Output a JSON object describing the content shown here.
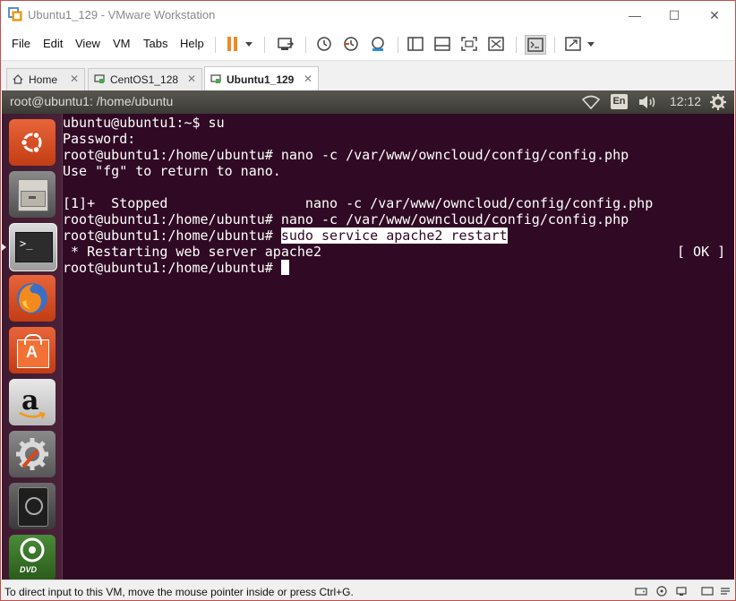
{
  "window": {
    "title": "Ubuntu1_129 - VMware Workstation",
    "minimize_glyph": "—",
    "maximize_glyph": "☐",
    "close_glyph": "✕"
  },
  "menu": {
    "items": [
      "File",
      "Edit",
      "View",
      "VM",
      "Tabs",
      "Help"
    ]
  },
  "tabs": [
    {
      "label": "Home",
      "active": false
    },
    {
      "label": "CentOS1_128",
      "active": false
    },
    {
      "label": "Ubuntu1_129",
      "active": true
    }
  ],
  "tab_close_glyph": "✕",
  "guest_panel": {
    "window_title": "root@ubuntu1: /home/ubuntu",
    "keyboard_layout": "En",
    "clock": "12:12"
  },
  "launcher": {
    "items": [
      "ubuntu-dash-icon",
      "files-icon",
      "terminal-icon",
      "firefox-icon",
      "software-center-icon",
      "amazon-icon",
      "system-settings-icon",
      "disk-icon",
      "dvd-icon"
    ]
  },
  "terminal": {
    "lines": [
      "ubuntu@ubuntu1:~$ su",
      "Password:",
      "root@ubuntu1:/home/ubuntu# nano -c /var/www/owncloud/config/config.php",
      "Use \"fg\" to return to nano.",
      "",
      "[1]+  Stopped                 nano -c /var/www/owncloud/config/config.php",
      "root@ubuntu1:/home/ubuntu# nano -c /var/www/owncloud/config/config.php"
    ],
    "prompt": "root@ubuntu1:/home/ubuntu# ",
    "highlighted_command": "sudo service apache2 restart",
    "restart_message": " * Restarting web server apache2",
    "ok_status": "[ OK ]",
    "final_prompt": "root@ubuntu1:/home/ubuntu# "
  },
  "statusbar": {
    "message": "To direct input to this VM, move the mouse pointer inside or press Ctrl+G."
  },
  "colors": {
    "terminal_bg": "#300a24",
    "panel_bg": "#3c3b37",
    "pause_orange": "#f08a24",
    "ubuntu_orange": "#dd4814"
  }
}
